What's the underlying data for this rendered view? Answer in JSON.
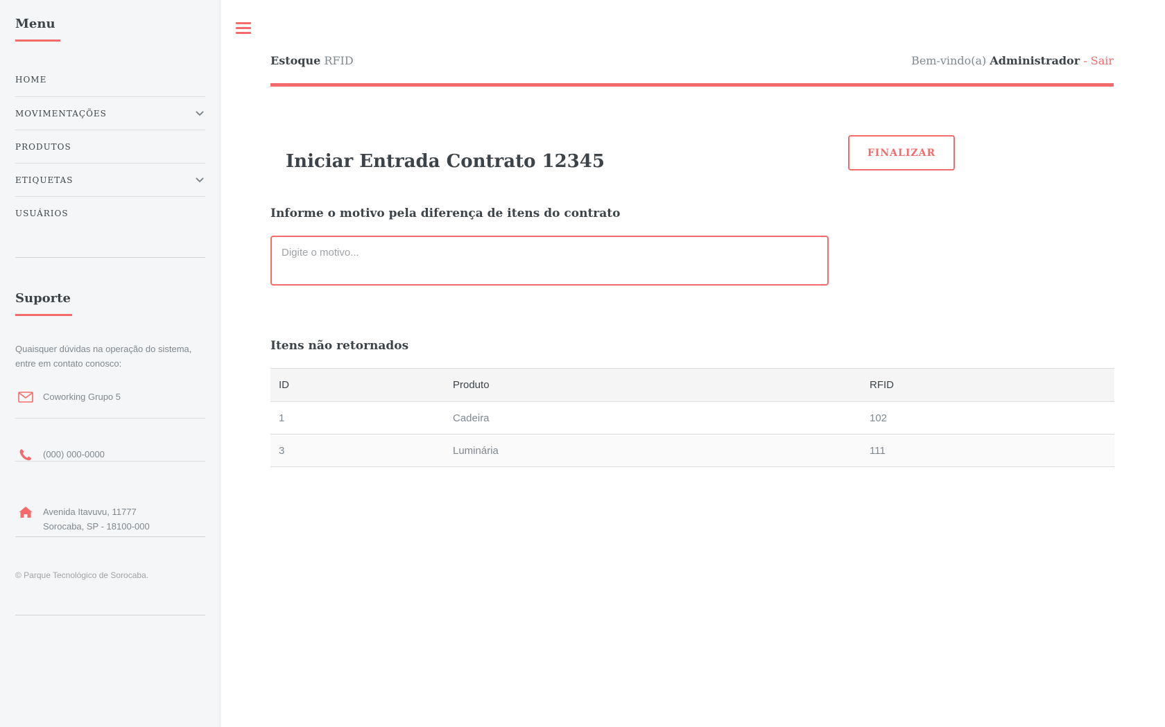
{
  "sidebar": {
    "menu_title": "Menu",
    "items": [
      {
        "label": "HOME"
      },
      {
        "label": "MOVIMENTAÇÕES"
      },
      {
        "label": "PRODUTOS"
      },
      {
        "label": "ETIQUETAS"
      },
      {
        "label": "USUÁRIOS"
      }
    ],
    "support_title": "Suporte",
    "support_text": "Quaisquer dúvidas na operação do sistema, entre em contato conosco:",
    "contact": {
      "email": "Coworking Grupo 5",
      "phone": "(000) 000-0000",
      "address_line1": "Avenida Itavuvu, 11777",
      "address_line2": "Sorocaba, SP - 18100-000"
    },
    "copyright": "© Parque Tecnológico de Sorocaba."
  },
  "header": {
    "brand_bold": "Estoque",
    "brand_light": "RFID",
    "welcome": "Bem-vindo(a)",
    "user": "Administrador",
    "separator": "-",
    "logout": "Sair"
  },
  "main": {
    "title": "Iniciar Entrada Contrato 12345",
    "finalize_button": "FINALIZAR",
    "reason_label": "Informe o motivo pela diferença de itens do contrato",
    "reason_placeholder": "Digite o motivo...",
    "reason_value": "",
    "table_title": "Itens não retornados",
    "table": {
      "headers": [
        "ID",
        "Produto",
        "RFID"
      ],
      "rows": [
        [
          "1",
          "Cadeira",
          "102"
        ],
        [
          "3",
          "Luminária",
          "111"
        ]
      ]
    }
  },
  "colors": {
    "accent": "#f56a6a",
    "text": "#3d4449",
    "muted": "#7f888f",
    "sidebar_bg": "#f5f6f7"
  }
}
